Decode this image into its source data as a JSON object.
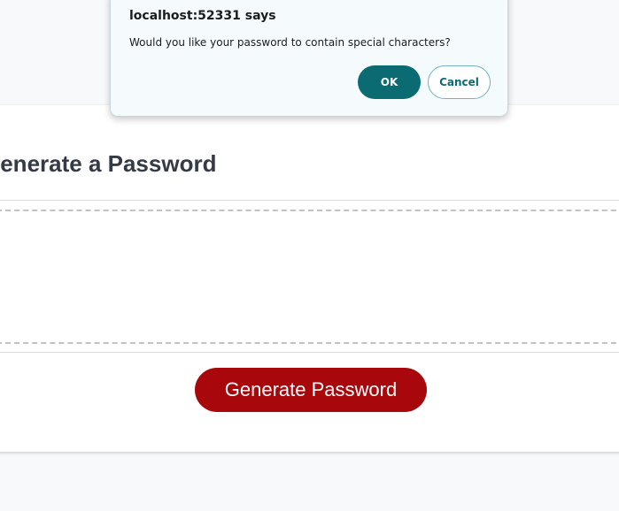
{
  "page": {
    "heading": "Generate a Password",
    "password_value": "",
    "generate_button_label": "Generate Password",
    "generate_button_color": "#a8080c"
  },
  "dialog": {
    "title": "localhost:52331 says",
    "message": "Would you like your password to contain special characters?",
    "ok_label": "OK",
    "cancel_label": "Cancel",
    "accent_color": "#0a6b73"
  }
}
